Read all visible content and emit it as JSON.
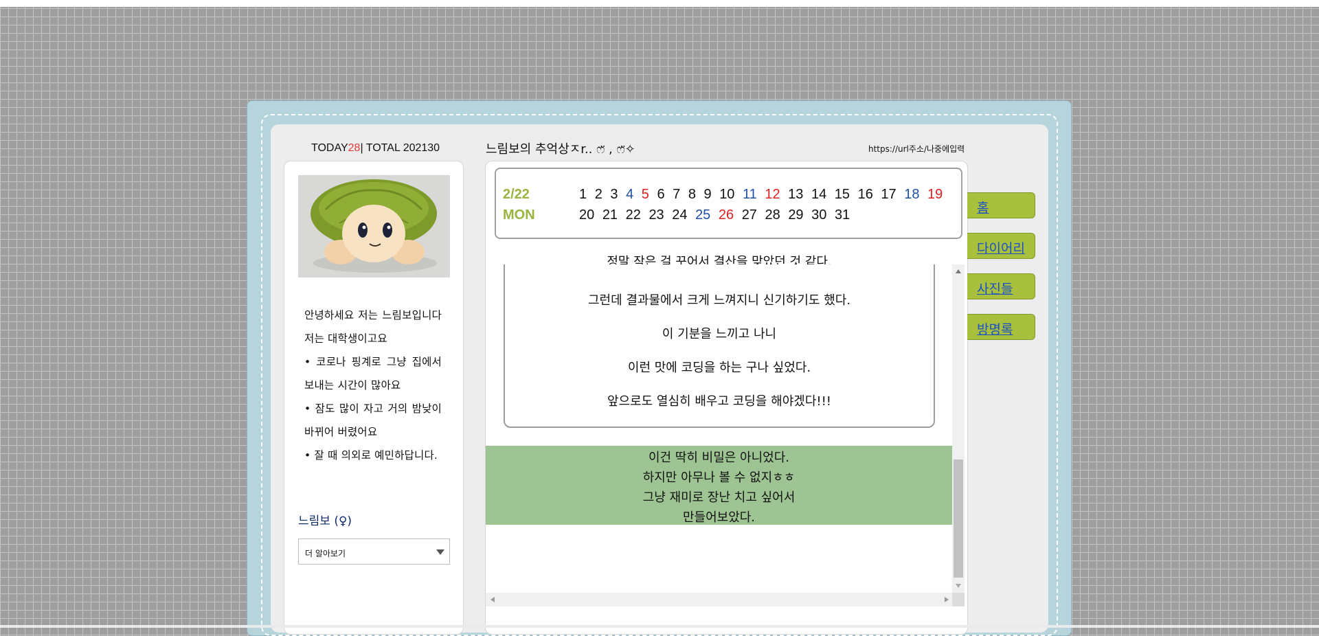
{
  "counter": {
    "today_label": "TODAY",
    "today_value": "28",
    "sep_total": "| TOTAL 202130"
  },
  "profile": {
    "intro_lines": [
      "안녕하세요 저는 느림보입니다 저는 대학생이고요",
      "•  코로나 핑계로 그냥 집에서 보내는 시간이 많아요",
      "•  잠도 많이 자고 거의 밤낮이 바뀌어 버렸어요",
      "•  잘 때 의외로 예민하답니다."
    ],
    "name": "느림보",
    "gender_symbol": "(♀)",
    "select_value": "더 알아보기"
  },
  "header": {
    "blog_title": "느림보의 추억상ㅈr.. ෆ̈ ,  ෆ̈✧",
    "url": "https://url주소/나중에입력"
  },
  "calendar": {
    "date": "2/22",
    "weekday": "MON",
    "days": [
      {
        "d": "1",
        "c": "black"
      },
      {
        "d": "2",
        "c": "black"
      },
      {
        "d": "3",
        "c": "black"
      },
      {
        "d": "4",
        "c": "blue"
      },
      {
        "d": "5",
        "c": "red"
      },
      {
        "d": "6",
        "c": "black"
      },
      {
        "d": "7",
        "c": "black"
      },
      {
        "d": "8",
        "c": "black"
      },
      {
        "d": "9",
        "c": "black"
      },
      {
        "d": "10",
        "c": "black"
      },
      {
        "d": "11",
        "c": "blue"
      },
      {
        "d": "12",
        "c": "red"
      },
      {
        "d": "13",
        "c": "black"
      },
      {
        "d": "14",
        "c": "black"
      },
      {
        "d": "15",
        "c": "black"
      },
      {
        "d": "16",
        "c": "black"
      },
      {
        "d": "17",
        "c": "black"
      },
      {
        "d": "18",
        "c": "blue"
      },
      {
        "d": "19",
        "c": "red"
      },
      {
        "d": "20",
        "c": "black"
      },
      {
        "d": "21",
        "c": "black"
      },
      {
        "d": "22",
        "c": "black"
      },
      {
        "d": "23",
        "c": "black"
      },
      {
        "d": "24",
        "c": "black"
      },
      {
        "d": "25",
        "c": "blue"
      },
      {
        "d": "26",
        "c": "red"
      },
      {
        "d": "27",
        "c": "black"
      },
      {
        "d": "28",
        "c": "black"
      },
      {
        "d": "29",
        "c": "black"
      },
      {
        "d": "30",
        "c": "black"
      },
      {
        "d": "31",
        "c": "black"
      }
    ],
    "colors": {
      "blue": "#1e4fa8",
      "red": "#e02020",
      "accent": "#9bb33f"
    }
  },
  "diary": {
    "lines": [
      "정말 작은 걸 꾸어서 결산을 맞았던 것 같다.",
      "그런데 결과물에서 크게 느껴지니 신기하기도 했다.",
      "이 기분을 느끼고 나니",
      "이런 맛에 코딩을 하는 구나 싶었다.",
      "앞으로도 열심히 배우고 코딩을 해야겠다!!!"
    ]
  },
  "secret": {
    "lines": [
      "이건 딱히 비밀은 아니었다.",
      "하지만 아무나 볼 수 없지ㅎㅎ",
      "그냥 재미로 장난 치고 싶어서",
      "만들어보았다."
    ],
    "bg_color": "#9dc492"
  },
  "menu": {
    "items": [
      {
        "label": "홈"
      },
      {
        "label": "다이어리"
      },
      {
        "label": "사진들"
      },
      {
        "label": "방명록"
      }
    ],
    "color": "#a8c03c"
  }
}
